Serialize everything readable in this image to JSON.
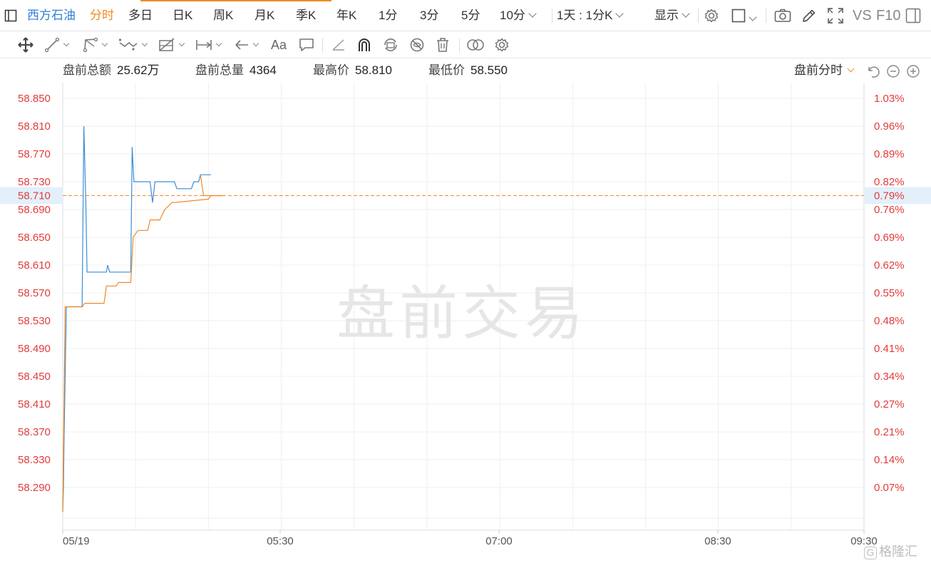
{
  "topbar": {
    "stock_name": "西方石油",
    "tabs": [
      "分时",
      "多日",
      "日K",
      "周K",
      "月K",
      "季K",
      "年K",
      "1分",
      "3分",
      "5分",
      "10分"
    ],
    "active_tab": "分时",
    "period_select": "1天 : 1分K",
    "display_label": "显示",
    "vs_label": "VS",
    "f10_label": "F10"
  },
  "toolbar": {
    "text_tool": "Aa"
  },
  "info": {
    "amount_label": "盘前总额",
    "amount_value": "25.62万",
    "volume_label": "盘前总量",
    "volume_value": "4364",
    "high_label": "最高价",
    "high_value": "58.810",
    "low_label": "最低价",
    "low_value": "58.550",
    "mode_label": "盘前分时"
  },
  "watermark": "盘前交易",
  "logo_text": "格隆汇",
  "colors": {
    "price_line": "#3b8ed8",
    "avg_line": "#f08a24",
    "axis_text": "#e23b3b",
    "accent": "#f08a24"
  },
  "chart_data": {
    "type": "line",
    "title": "",
    "xlabel": "",
    "ylabel": "",
    "x_ticks": [
      "05/19",
      "05:30",
      "07:00",
      "08:30",
      "09:30"
    ],
    "x_range_minutes": [
      240,
      570
    ],
    "ylim": [
      58.25,
      58.87
    ],
    "y_ticks_left": [
      "58.850",
      "58.810",
      "58.770",
      "58.730",
      "58.690",
      "58.650",
      "58.610",
      "58.570",
      "58.530",
      "58.490",
      "58.450",
      "58.410",
      "58.370",
      "58.330",
      "58.290"
    ],
    "y_ticks_right": [
      "1.03%",
      "0.96%",
      "0.89%",
      "0.82%",
      "0.76%",
      "0.69%",
      "0.62%",
      "0.55%",
      "0.48%",
      "0.41%",
      "0.34%",
      "0.27%",
      "0.21%",
      "0.14%",
      "0.07%"
    ],
    "current_price": "58.710",
    "current_change": "0.79%",
    "series": [
      {
        "key": "price",
        "x": [
          240.0,
          240.3,
          240.6,
          241.0,
          241.5,
          248.0,
          248.7,
          249.5,
          250.0,
          258.0,
          258.5,
          259.3,
          260.0,
          260.6,
          261.2,
          268.0,
          268.6,
          269.3,
          270.0,
          270.7,
          271.2,
          272.0,
          276.0,
          277.0,
          278.0,
          280.0,
          286.0,
          287.0,
          293.0,
          294.0,
          296.0,
          296.7,
          301.0
        ],
        "values": [
          58.255,
          58.29,
          58.37,
          58.45,
          58.55,
          58.55,
          58.81,
          58.7,
          58.6,
          58.6,
          58.61,
          58.6,
          58.6,
          58.6,
          58.6,
          58.6,
          58.78,
          58.73,
          58.73,
          58.73,
          58.73,
          58.73,
          58.73,
          58.7,
          58.73,
          58.73,
          58.73,
          58.72,
          58.72,
          58.73,
          58.73,
          58.74,
          58.74
        ]
      },
      {
        "key": "average",
        "x": [
          240.0,
          241.0,
          243.0,
          248.0,
          249.0,
          257.0,
          258.0,
          262.0,
          263.0,
          268.0,
          269.0,
          271.0,
          272.0,
          275.0,
          276.0,
          280.0,
          282.0,
          285.0,
          286.0,
          300.0,
          301.0,
          306.0
        ],
        "values": [
          58.255,
          58.55,
          58.55,
          58.55,
          58.555,
          58.555,
          58.58,
          58.58,
          58.585,
          58.585,
          58.65,
          58.66,
          58.66,
          58.66,
          58.675,
          58.675,
          58.69,
          58.7,
          58.7,
          58.705,
          58.71,
          58.71
        ]
      },
      {
        "key": "tail",
        "x": [
          296.7,
          298.0,
          299.0,
          306.0
        ],
        "values": [
          58.74,
          58.71,
          58.71,
          58.71
        ]
      }
    ]
  }
}
